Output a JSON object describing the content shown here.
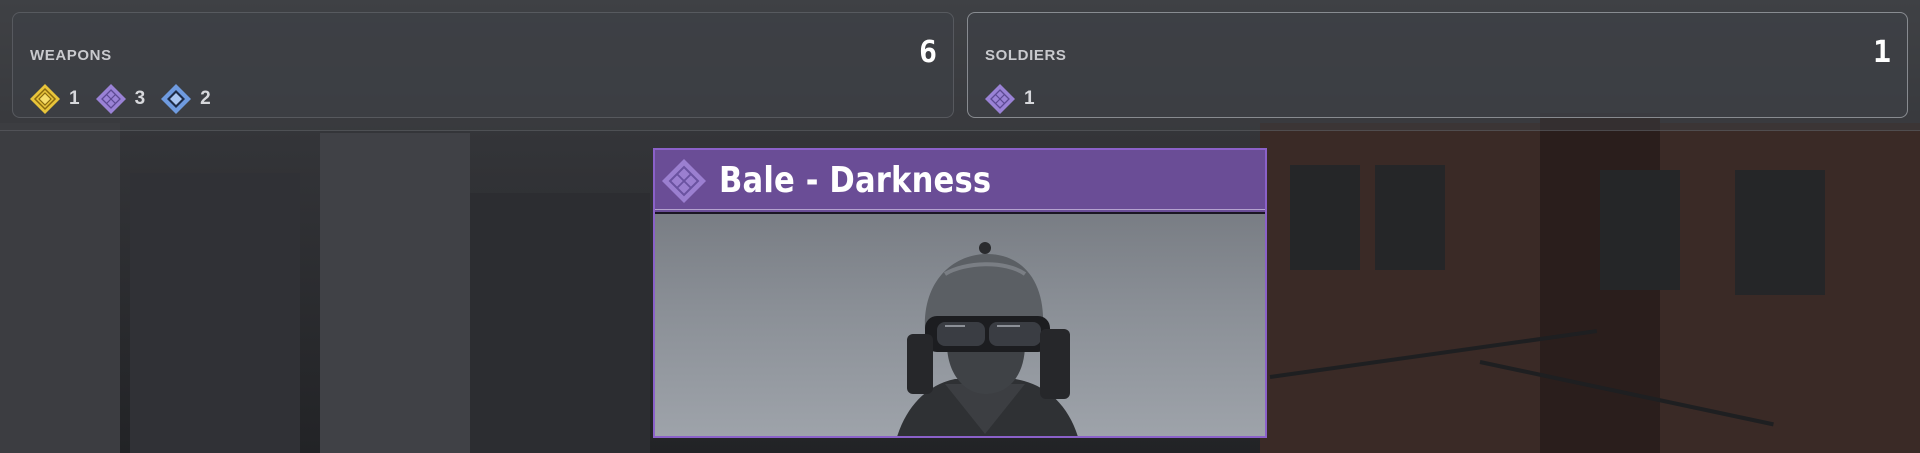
{
  "weapons_panel": {
    "title": "WEAPONS",
    "total": "6",
    "badges": [
      {
        "icon": "rarity-gold-icon",
        "color": "#e8c43a",
        "count": "1"
      },
      {
        "icon": "rarity-purple-icon",
        "color": "#9a82d6",
        "count": "3"
      },
      {
        "icon": "rarity-blue-icon",
        "color": "#6f9be0",
        "count": "2"
      }
    ]
  },
  "soldiers_panel": {
    "title": "SOLDIERS",
    "total": "1",
    "badges": [
      {
        "icon": "rarity-purple-icon",
        "color": "#9a82d6",
        "count": "1"
      }
    ]
  },
  "card": {
    "title": "Bale - Darkness",
    "rarity_icon": "rarity-purple-icon",
    "accent_color": "#8b61c9",
    "header_color": "#6a4d96",
    "image": "soldier-portrait"
  }
}
